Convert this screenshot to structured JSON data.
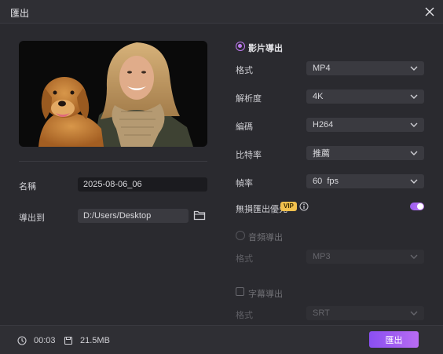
{
  "window": {
    "title": "匯出"
  },
  "left": {
    "name_label": "名稱",
    "name_value": "2025-08-06_06",
    "path_label": "導出到",
    "path_value": "D:/Users/Desktop"
  },
  "video_export": {
    "label": "影片導出",
    "rows": [
      {
        "label": "格式",
        "value": "MP4"
      },
      {
        "label": "解析度",
        "value": "4K"
      },
      {
        "label": "編碼",
        "value": "H264"
      },
      {
        "label": "比特率",
        "value": "推薦"
      },
      {
        "label": "幀率",
        "value": "60  fps"
      }
    ],
    "lossless_label": "無損匯出優先",
    "vip_badge": "VIP",
    "lossless_enabled": true
  },
  "audio_export": {
    "label": "音頻導出",
    "format_label": "格式",
    "format_value": "MP3"
  },
  "subtitle_export": {
    "label": "字幕導出",
    "format_label": "格式",
    "format_value": "SRT"
  },
  "footer": {
    "duration": "00:03",
    "size": "21.5MB",
    "export_label": "匯出"
  },
  "colors": {
    "accent": "#b86cf3",
    "vip": "#f2c14e",
    "background": "#2a2a2f"
  }
}
